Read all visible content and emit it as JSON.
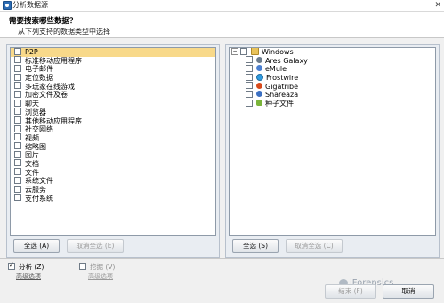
{
  "window": {
    "title": "分析数据源",
    "close_glyph": "✕"
  },
  "header": {
    "heading": "需要搜索哪些数据？",
    "subheading": "从下列支持的数据类型中选择"
  },
  "left_list": {
    "items": [
      {
        "label": "P2P",
        "selected": true
      },
      {
        "label": "标准移动应用程序"
      },
      {
        "label": "电子邮件"
      },
      {
        "label": "定位数据"
      },
      {
        "label": "多玩家在线游戏"
      },
      {
        "label": "加密文件及卷"
      },
      {
        "label": "聊天"
      },
      {
        "label": "浏览器"
      },
      {
        "label": "其他移动应用程序"
      },
      {
        "label": "社交网络"
      },
      {
        "label": "视频"
      },
      {
        "label": "缩略图"
      },
      {
        "label": "图片"
      },
      {
        "label": "文档"
      },
      {
        "label": "文件"
      },
      {
        "label": "系统文件"
      },
      {
        "label": "云服务"
      },
      {
        "label": "支付系统"
      }
    ],
    "select_all": "全选 (A)",
    "deselect_all": "取消全选 (E)"
  },
  "right_tree": {
    "root": "Windows",
    "items": [
      {
        "label": "Ares Galaxy",
        "icon": "ares-icon"
      },
      {
        "label": "eMule",
        "icon": "emule-icon"
      },
      {
        "label": "Frostwire",
        "icon": "frostwire-icon"
      },
      {
        "label": "Gigatribe",
        "icon": "gigatribe-icon"
      },
      {
        "label": "Shareaza",
        "icon": "shareaza-icon"
      },
      {
        "label": "种子文件",
        "icon": "seed-icon"
      }
    ],
    "select_all": "全选 (S)",
    "deselect_all": "取消全选 (C)"
  },
  "options": {
    "analyze": {
      "label": "分析 (Z)",
      "checked": true,
      "advanced": "高级选项"
    },
    "carve": {
      "label": "挖掘 (V)",
      "checked": false,
      "advanced": "高级选项"
    }
  },
  "footer": {
    "finish": "结束 (F)",
    "cancel": "取消",
    "watermark": "iForensics"
  }
}
